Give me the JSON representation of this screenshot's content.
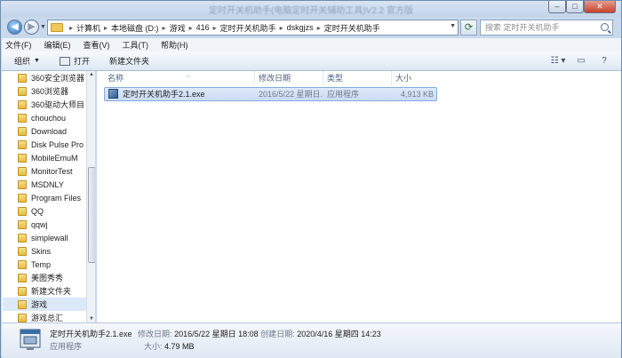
{
  "window": {
    "title": "定时开关机助手(电脑定时开关辅助工具)V2.2 官方版",
    "buttons": {
      "minimize": "–",
      "maximize": "□",
      "close": "✕"
    }
  },
  "address": {
    "crumbs": [
      "计算机",
      "本地磁盘 (D:)",
      "游戏",
      "416",
      "定时开关机助手",
      "dskgjzs",
      "定时开关机助手"
    ],
    "search_placeholder": "搜索 定时开关机助手"
  },
  "menu": [
    "文件(F)",
    "编辑(E)",
    "查看(V)",
    "工具(T)",
    "帮助(H)"
  ],
  "toolbar": {
    "organize": "组织",
    "open": "打开",
    "new_folder": "新建文件夹"
  },
  "sidebar": {
    "items": [
      "360安全浏览器",
      "360浏览器",
      "360驱动大师目",
      "chouchou",
      "Download",
      "Disk Pulse Pro",
      "MobileEmuM",
      "MonitorTest",
      "MSDNLY",
      "Program Files",
      "QQ",
      "qqwj",
      "simplewall",
      "Skins",
      "Temp",
      "美图秀秀",
      "新建文件夹",
      "游戏",
      "游戏总汇"
    ],
    "selected_index": 17
  },
  "columns": {
    "name": "名称",
    "modified": "修改日期",
    "type": "类型",
    "size": "大小"
  },
  "files": [
    {
      "name": "定时开关机助手2.1.exe",
      "modified": "2016/5/22 星期日...",
      "type": "应用程序",
      "size": "4,913 KB"
    }
  ],
  "details": {
    "filename": "定时开关机助手2.1.exe",
    "modified_label": "修改日期:",
    "modified_value": "2016/5/22 星期日 18:08",
    "created_label": "创建日期:",
    "created_value": "2020/4/16 星期四 14:23",
    "type": "应用程序",
    "size_label": "大小:",
    "size_value": "4.79 MB"
  }
}
